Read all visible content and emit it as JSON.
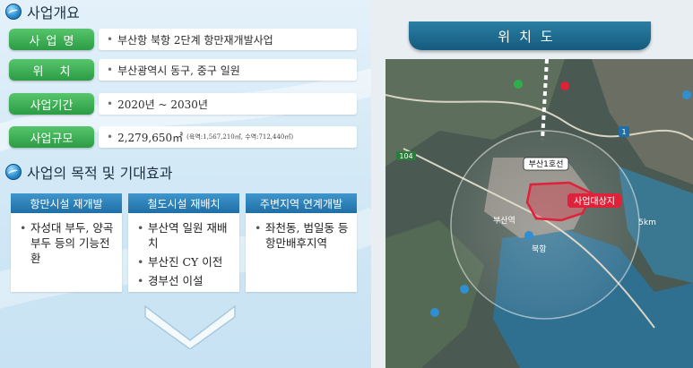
{
  "overview": {
    "heading": "사업개요",
    "rows": [
      {
        "label": "사업명",
        "value": "부산항 북항 2단계 항만재개발사업",
        "detail": ""
      },
      {
        "label": "위치",
        "value": "부산광역시 동구, 중구 일원",
        "detail": ""
      },
      {
        "label": "사업기간",
        "value": "2020년 ~ 2030년",
        "detail": ""
      },
      {
        "label": "사업규모",
        "value": "2,279,650㎡",
        "detail": "(육역:1,567,210㎡, 수역:712,440㎡)"
      }
    ]
  },
  "purpose": {
    "heading": "사업의 목적 및 기대효과",
    "columns": [
      {
        "title": "항만시설 재개발",
        "items": [
          "자성대 부두, 양곡부두 등의 기능전환"
        ]
      },
      {
        "title": "철도시설 재배치",
        "items": [
          "부산역 일원 재배치",
          "부산진 CY 이전",
          "경부선 이설"
        ]
      },
      {
        "title": "주변지역 연계개발",
        "items": [
          "좌천동, 범일동 등 항만배후지역"
        ]
      }
    ]
  },
  "map": {
    "title": "위치도",
    "labels": {
      "subway_line": "부산1호선",
      "site": "사업대상지",
      "radius": "5km",
      "station": "부산역",
      "port": "북항",
      "route": "104",
      "highway": "1"
    },
    "colors": {
      "site": "#e0213a",
      "pill": "#2f9c47",
      "header": "#1f6fa6"
    }
  },
  "icons": {
    "heading_icon": "globe-icon",
    "expand": "chevron-down-icon"
  }
}
